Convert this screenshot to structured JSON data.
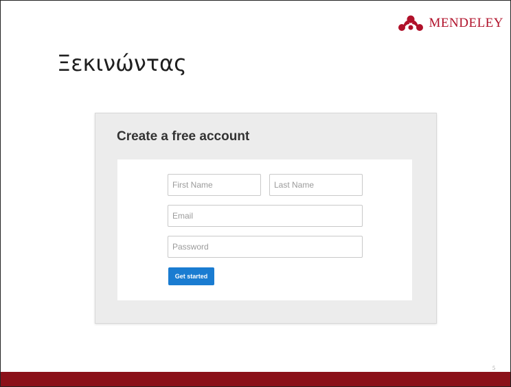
{
  "slide": {
    "title": "Ξεκινώντας",
    "page_number": "5"
  },
  "logo": {
    "text": "MENDELEY",
    "icon": "mendeley-logo-icon",
    "color": "#b0112a"
  },
  "form": {
    "title": "Create a free account",
    "first_name_placeholder": "First Name",
    "last_name_placeholder": "Last Name",
    "email_placeholder": "Email",
    "password_placeholder": "Password",
    "first_name_value": "",
    "last_name_value": "",
    "email_value": "",
    "password_value": "",
    "submit_label": "Get started",
    "submit_color": "#1a7cd1"
  },
  "footer": {
    "bar_color": "#8b1119"
  }
}
